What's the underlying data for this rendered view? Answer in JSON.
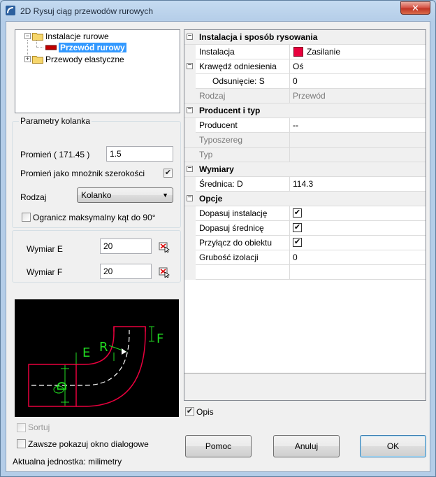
{
  "window": {
    "title": "2D Rysuj ciąg przewodów rurowych",
    "close_label": "✕"
  },
  "tree": {
    "items": [
      {
        "label": "Instalacje rurowe",
        "expander": "−"
      },
      {
        "label": "Przewód rurowy",
        "selected": true
      },
      {
        "label": "Przewody elastyczne",
        "expander": "+"
      }
    ],
    "pipe_color": "#c00000"
  },
  "elbow_params": {
    "group_title": "Parametry kolanka",
    "radius_label": "Promień ( 171.45 )",
    "radius_value": "1.5",
    "radius_multiplier_label": "Promień jako mnożnik szerokości",
    "radius_multiplier_checked": true,
    "type_label": "Rodzaj",
    "type_value": "Kolanko",
    "limit_angle_label": "Ogranicz maksymalny kąt do 90°",
    "limit_angle_checked": false
  },
  "dimensions": {
    "e_label": "Wymiar E",
    "e_value": "20",
    "f_label": "Wymiar F",
    "f_value": "20"
  },
  "preview": {
    "labels": {
      "e": "E",
      "r": "R",
      "f": "F",
      "d": "D"
    },
    "colors": {
      "pipe": "#e8003d",
      "dim": "#22dd22",
      "center": "#ffffff"
    }
  },
  "bottom_left": {
    "sort_label": "Sortuj",
    "sort_checked": false,
    "always_show_label": "Zawsze pokazuj okno dialogowe",
    "always_show_checked": false,
    "units_text": "Aktualna jednostka: milimetry"
  },
  "property_grid": {
    "cat_install": "Instalacja i sposób rysowania",
    "installation_name": "Instalacja",
    "installation_value": "Zasilanie",
    "installation_color": "#e8003d",
    "ref_edge_name": "Krawędź odniesienia",
    "ref_edge_value": "Oś",
    "offset_name": "Odsunięcie: S",
    "offset_value": "0",
    "kind_name": "Rodzaj",
    "kind_value": "Przewód",
    "cat_producer": "Producent i typ",
    "producer_name": "Producent",
    "producer_value": "--",
    "series_name": "Typoszereg",
    "type_name": "Typ",
    "cat_dims": "Wymiary",
    "diameter_name": "Średnica: D",
    "diameter_value": "114.3",
    "cat_options": "Opcje",
    "fit_install_name": "Dopasuj instalację",
    "fit_diameter_name": "Dopasuj średnicę",
    "attach_name": "Przyłącz do obiektu",
    "insulation_name": "Grubość izolacji",
    "insulation_value": "0",
    "check_mark": "✔",
    "toggle_mark": "−"
  },
  "opis": {
    "label": "Opis",
    "checked": true
  },
  "buttons": {
    "help": "Pomoc",
    "cancel": "Anuluj",
    "ok": "OK"
  }
}
